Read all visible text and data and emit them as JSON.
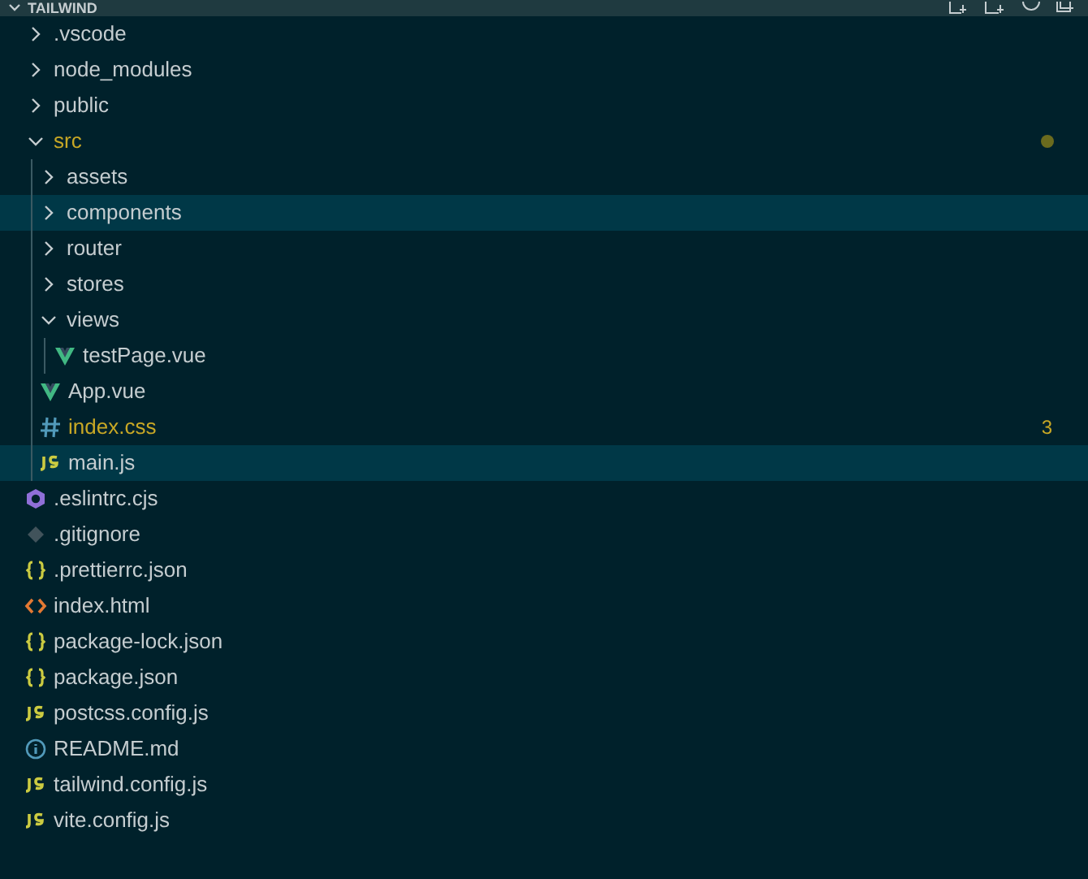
{
  "explorer": {
    "title": "TAILWIND"
  },
  "tree": [
    {
      "name": ".vscode",
      "kind": "folder",
      "expanded": false,
      "selected": false,
      "modified": false
    },
    {
      "name": "node_modules",
      "kind": "folder",
      "expanded": false,
      "selected": false,
      "modified": false
    },
    {
      "name": "public",
      "kind": "folder",
      "expanded": false,
      "selected": false,
      "modified": false
    },
    {
      "name": "src",
      "kind": "folder",
      "expanded": true,
      "selected": false,
      "modified": true,
      "children": [
        {
          "name": "assets",
          "kind": "folder",
          "expanded": false,
          "selected": false,
          "modified": false
        },
        {
          "name": "components",
          "kind": "folder",
          "expanded": false,
          "selected": true,
          "modified": false
        },
        {
          "name": "router",
          "kind": "folder",
          "expanded": false,
          "selected": false,
          "modified": false
        },
        {
          "name": "stores",
          "kind": "folder",
          "expanded": false,
          "selected": false,
          "modified": false
        },
        {
          "name": "views",
          "kind": "folder",
          "expanded": true,
          "selected": false,
          "modified": false,
          "children": [
            {
              "name": "testPage.vue",
              "kind": "vue",
              "selected": false,
              "modified": false
            }
          ]
        },
        {
          "name": "App.vue",
          "kind": "vue",
          "selected": false,
          "modified": false
        },
        {
          "name": "index.css",
          "kind": "css",
          "selected": false,
          "modified": true,
          "problems": "3"
        },
        {
          "name": "main.js",
          "kind": "js",
          "selected": true,
          "modified": false
        }
      ]
    },
    {
      "name": ".eslintrc.cjs",
      "kind": "eslint",
      "selected": false,
      "modified": false
    },
    {
      "name": ".gitignore",
      "kind": "git",
      "selected": false,
      "modified": false
    },
    {
      "name": ".prettierrc.json",
      "kind": "json",
      "selected": false,
      "modified": false
    },
    {
      "name": "index.html",
      "kind": "html",
      "selected": false,
      "modified": false
    },
    {
      "name": "package-lock.json",
      "kind": "json",
      "selected": false,
      "modified": false
    },
    {
      "name": "package.json",
      "kind": "json",
      "selected": false,
      "modified": false
    },
    {
      "name": "postcss.config.js",
      "kind": "js",
      "selected": false,
      "modified": false
    },
    {
      "name": "README.md",
      "kind": "info",
      "selected": false,
      "modified": false
    },
    {
      "name": "tailwind.config.js",
      "kind": "js",
      "selected": false,
      "modified": false
    },
    {
      "name": "vite.config.js",
      "kind": "js",
      "selected": false,
      "modified": false
    }
  ]
}
